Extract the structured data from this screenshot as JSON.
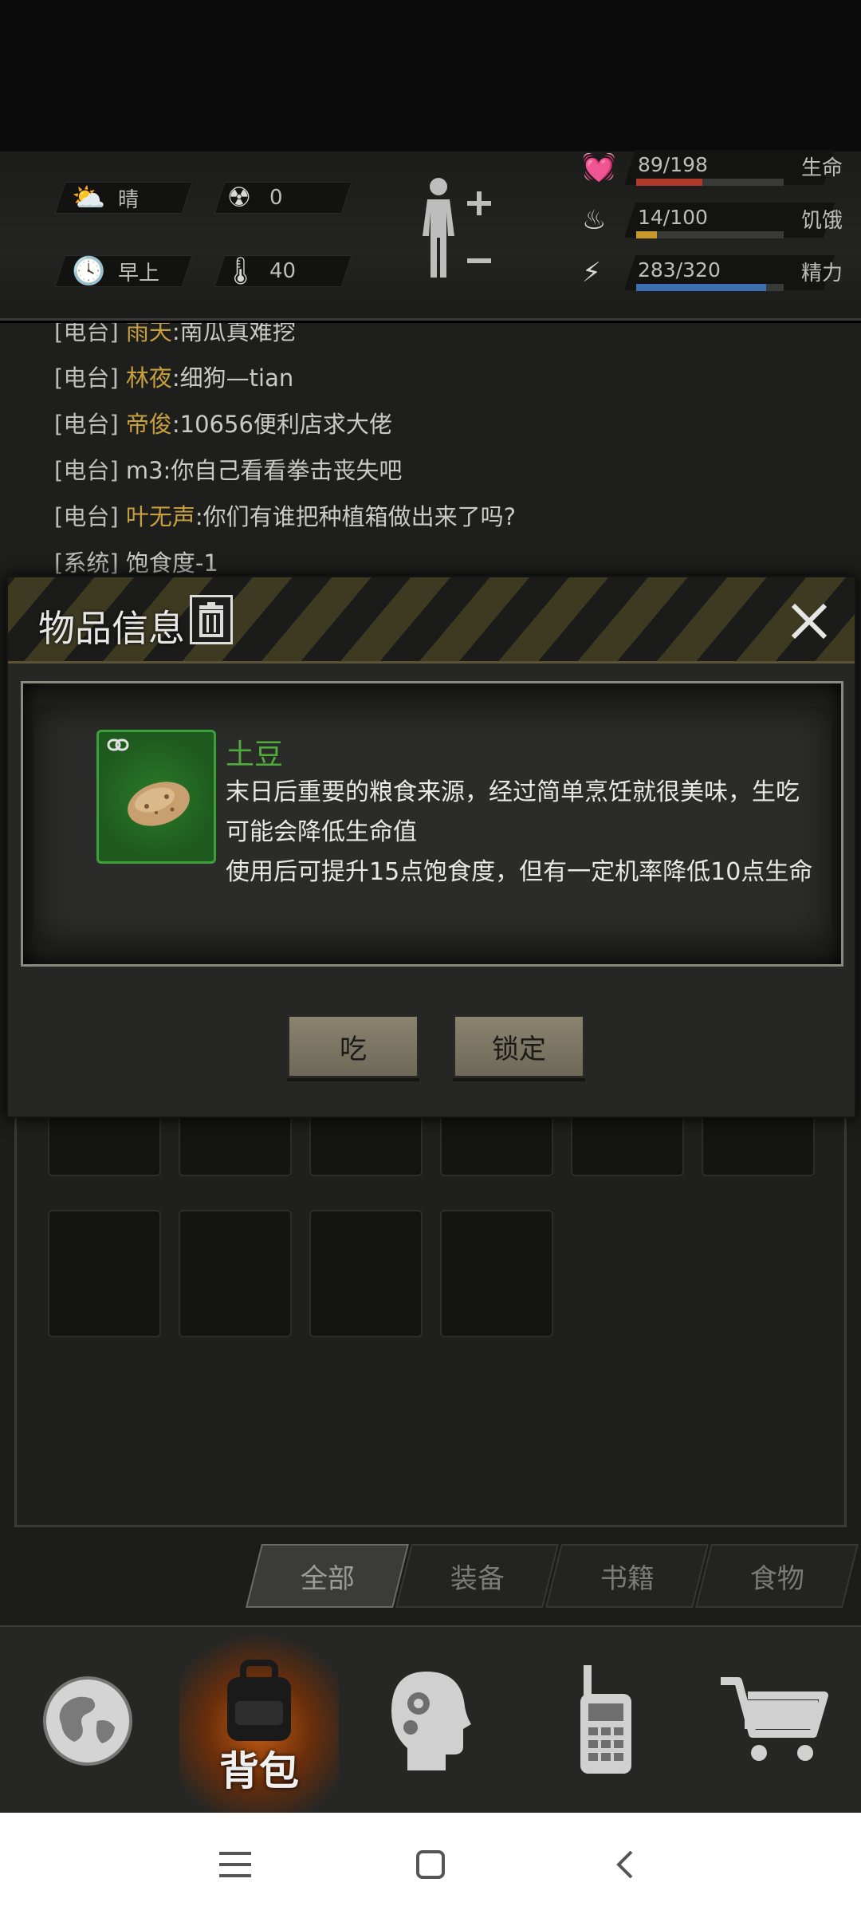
{
  "status": {
    "weather_label": "晴",
    "radiation_value": "0",
    "time_label": "早上",
    "temperature_value": "40",
    "health": {
      "value_text": "89/198",
      "label": "生命",
      "fraction": 0.45,
      "color": "#b23a2a"
    },
    "hunger": {
      "value_text": "14/100",
      "label": "饥饿",
      "fraction": 0.14,
      "color": "#c79a2a"
    },
    "energy": {
      "value_text": "283/320",
      "label": "精力",
      "fraction": 0.88,
      "color": "#3b6fb0"
    }
  },
  "chat": {
    "lines": [
      {
        "tag": "[电台]",
        "name": "雨天",
        "msg": ":南瓜真难挖"
      },
      {
        "tag": "[电台]",
        "name": "林夜",
        "msg": ":细狗—tian"
      },
      {
        "tag": "[电台]",
        "name": "帝俊",
        "msg": ":10656便利店求大佬"
      },
      {
        "tag": "[电台]",
        "name": "",
        "msg": "m3:你自己看看拳击丧失吧"
      },
      {
        "tag": "[电台]",
        "name": "叶无声",
        "msg": ":你们有谁把种植箱做出来了吗?"
      },
      {
        "tag": "[系统]",
        "name": "",
        "msg": "饱食度-1"
      }
    ]
  },
  "dialog": {
    "title": "物品信息",
    "item_name": "土豆",
    "item_desc_1": "末日后重要的粮食来源，经过简单烹饪就很美味，生吃可能会降低生命值",
    "item_desc_2": "使用后可提升15点饱食度，但有一定机率降低10点生命",
    "eat_label": "吃",
    "lock_label": "锁定"
  },
  "tabs": [
    "全部",
    "装备",
    "书籍",
    "食物"
  ],
  "nav": {
    "backpack_label": "背包"
  }
}
